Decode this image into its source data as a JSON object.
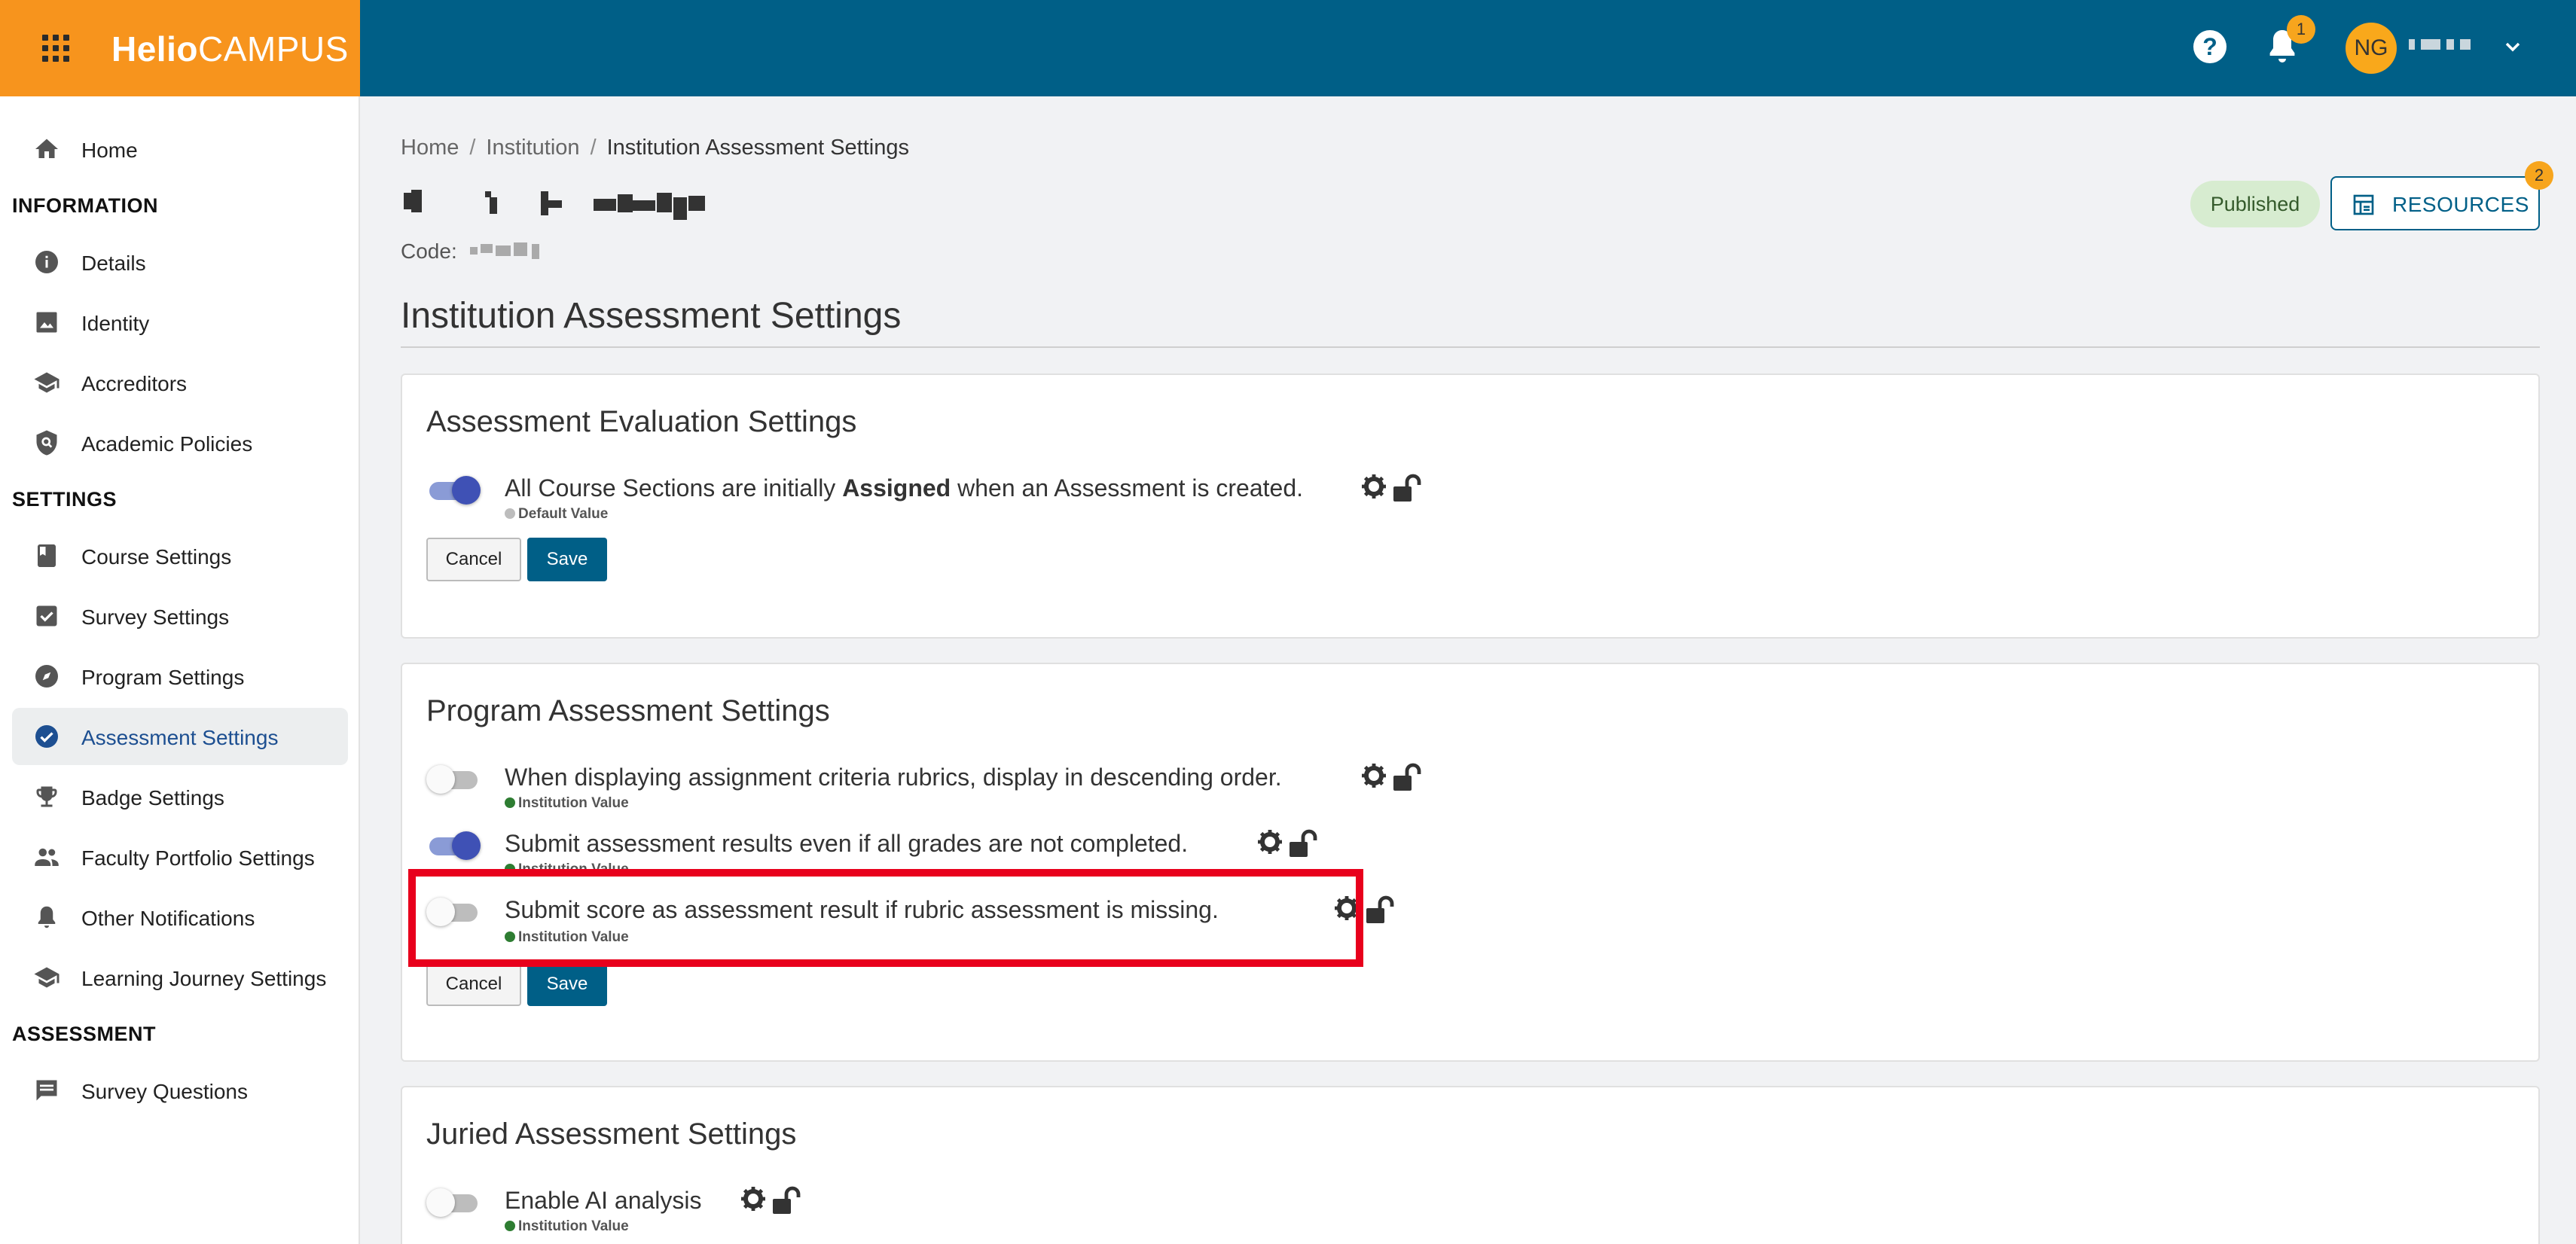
{
  "header": {
    "logo_bold": "Helio",
    "logo_light": "CAMPUS",
    "notification_count": "1",
    "avatar_initials": "NG"
  },
  "sidebar": {
    "home": "Home",
    "section_information": "INFORMATION",
    "details": "Details",
    "identity": "Identity",
    "accreditors": "Accreditors",
    "academic_policies": "Academic Policies",
    "section_settings": "SETTINGS",
    "course_settings": "Course Settings",
    "survey_settings": "Survey Settings",
    "program_settings": "Program Settings",
    "assessment_settings": "Assessment Settings",
    "badge_settings": "Badge Settings",
    "faculty_portfolio_settings": "Faculty Portfolio Settings",
    "other_notifications": "Other Notifications",
    "learning_journey_settings": "Learning Journey Settings",
    "section_assessment": "ASSESSMENT",
    "survey_questions": "Survey Questions"
  },
  "breadcrumb": {
    "home": "Home",
    "institution": "Institution",
    "current": "Institution Assessment Settings"
  },
  "page": {
    "code_label": "Code:",
    "status": "Published",
    "resources_label": "RESOURCES",
    "resources_count": "2",
    "title": "Institution Assessment Settings"
  },
  "cards": {
    "evaluation": {
      "title": "Assessment Evaluation Settings",
      "setting_pre": "All Course Sections are initially ",
      "setting_bold": "Assigned",
      "setting_post": " when an Assessment is created.",
      "caption": "Default Value",
      "toggle_on": true
    },
    "program": {
      "title": "Program Assessment Settings",
      "setting1": "When displaying assignment criteria rubrics, display in descending order.",
      "caption1": "Institution Value",
      "setting2": "Submit assessment results even if all grades are not completed.",
      "caption2": "Institution Value",
      "setting3": "Submit score as assessment result if rubric assessment is missing.",
      "caption3": "Institution Value"
    },
    "juried": {
      "title": "Juried Assessment Settings",
      "setting1": "Enable AI analysis",
      "caption1": "Institution Value"
    },
    "cancel_label": "Cancel",
    "save_label": "Save"
  },
  "colors": {
    "header_bg": "#005f87",
    "brand_orange": "#f7941d",
    "institution_dot": "#2e7d32",
    "default_dot": "#bdbdbd",
    "highlight": "#e8001c"
  }
}
